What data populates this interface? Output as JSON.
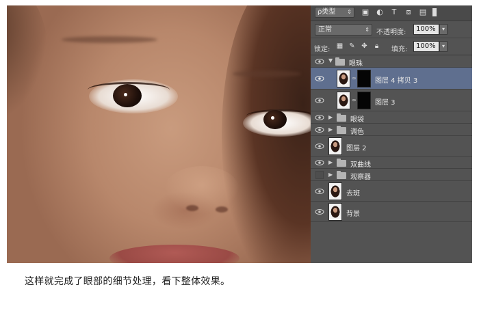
{
  "panel": {
    "filter_label": "ρ类型",
    "toolbar_icons": [
      "image-icon",
      "circle-half-icon",
      "text-icon",
      "transform-icon",
      "smart-object-icon"
    ],
    "blend_mode": "正常",
    "opacity_label": "不透明度:",
    "opacity_value": "100%",
    "lock_label": "锁定:",
    "lock_icons": [
      "lock-transparent-icon",
      "lock-paint-icon",
      "lock-move-icon",
      "lock-all-icon"
    ],
    "fill_label": "填充:",
    "fill_value": "100%"
  },
  "layers": [
    {
      "name": "眼珠",
      "kind": "group",
      "expanded": true,
      "visible": true
    },
    {
      "name": "图层 4 拷贝 3",
      "kind": "layer-mask",
      "selected": true,
      "visible": true
    },
    {
      "name": "图层 3",
      "kind": "layer-mask",
      "visible": true
    },
    {
      "name": "眼袋",
      "kind": "group",
      "expanded": false,
      "visible": true
    },
    {
      "name": "调色",
      "kind": "group",
      "expanded": false,
      "visible": true
    },
    {
      "name": "图层 2",
      "kind": "layer",
      "visible": true
    },
    {
      "name": "双曲线",
      "kind": "group",
      "expanded": false,
      "visible": true
    },
    {
      "name": "观察器",
      "kind": "group",
      "expanded": false,
      "visible": false
    },
    {
      "name": "去斑",
      "kind": "layer",
      "visible": true
    },
    {
      "name": "背景",
      "kind": "layer",
      "visible": true
    }
  ],
  "caption": "这样就完成了眼部的细节处理，看下整体效果。",
  "colors": {
    "panel_bg": "#535353",
    "selected_row": "#5f6f8f"
  }
}
